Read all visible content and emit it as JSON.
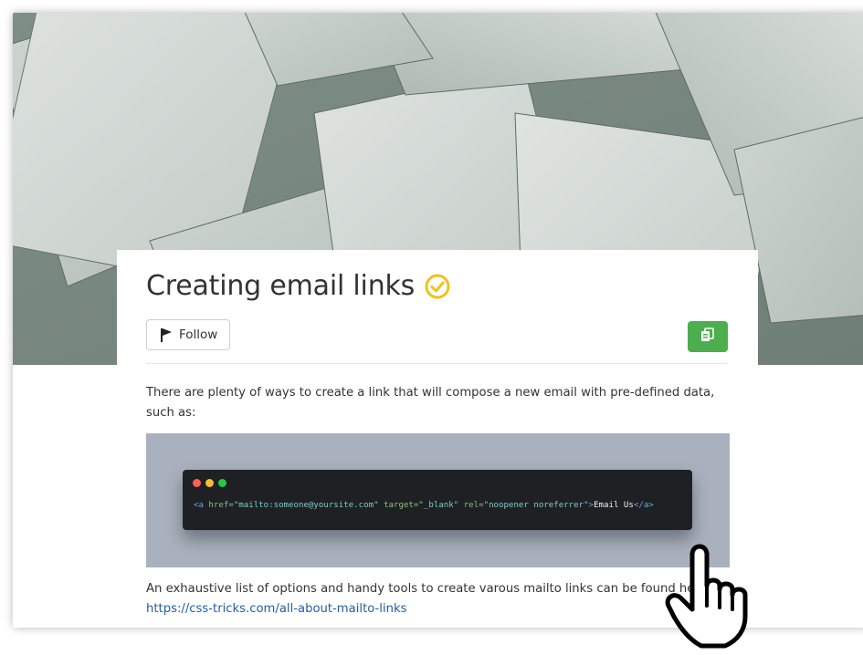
{
  "article": {
    "title": "Creating email links",
    "verified_icon": "check-circle-icon",
    "verified_color": "#f0c21a",
    "follow_label": "Follow",
    "export_icon": "copy-doc-icon",
    "export_color": "#4cae4c",
    "paragraph1": "There are plenty of ways to create a link that will compose a new email with pre-defined data, such as:",
    "code_window_dots": [
      "#ff5f56",
      "#ffbd2e",
      "#27c93f"
    ],
    "code": {
      "open_tag": "<a",
      "href_attr": " href=",
      "href_val": "\"mailto:someone@yoursite.com\"",
      "target_attr": " target=",
      "target_val": "\"_blank\"",
      "rel_attr": " rel=",
      "rel_val": "\"noopener noreferrer\"",
      "close_open": ">",
      "text": "Email Us",
      "close_tag": "</a>"
    },
    "paragraph2_prefix": "An exhaustive list of options and handy tools to create varous mailto links can be found here: ",
    "paragraph2_link": "https://css-tricks.com/all-about-mailto-links"
  },
  "cursor_icon": "hand-pointer-icon"
}
